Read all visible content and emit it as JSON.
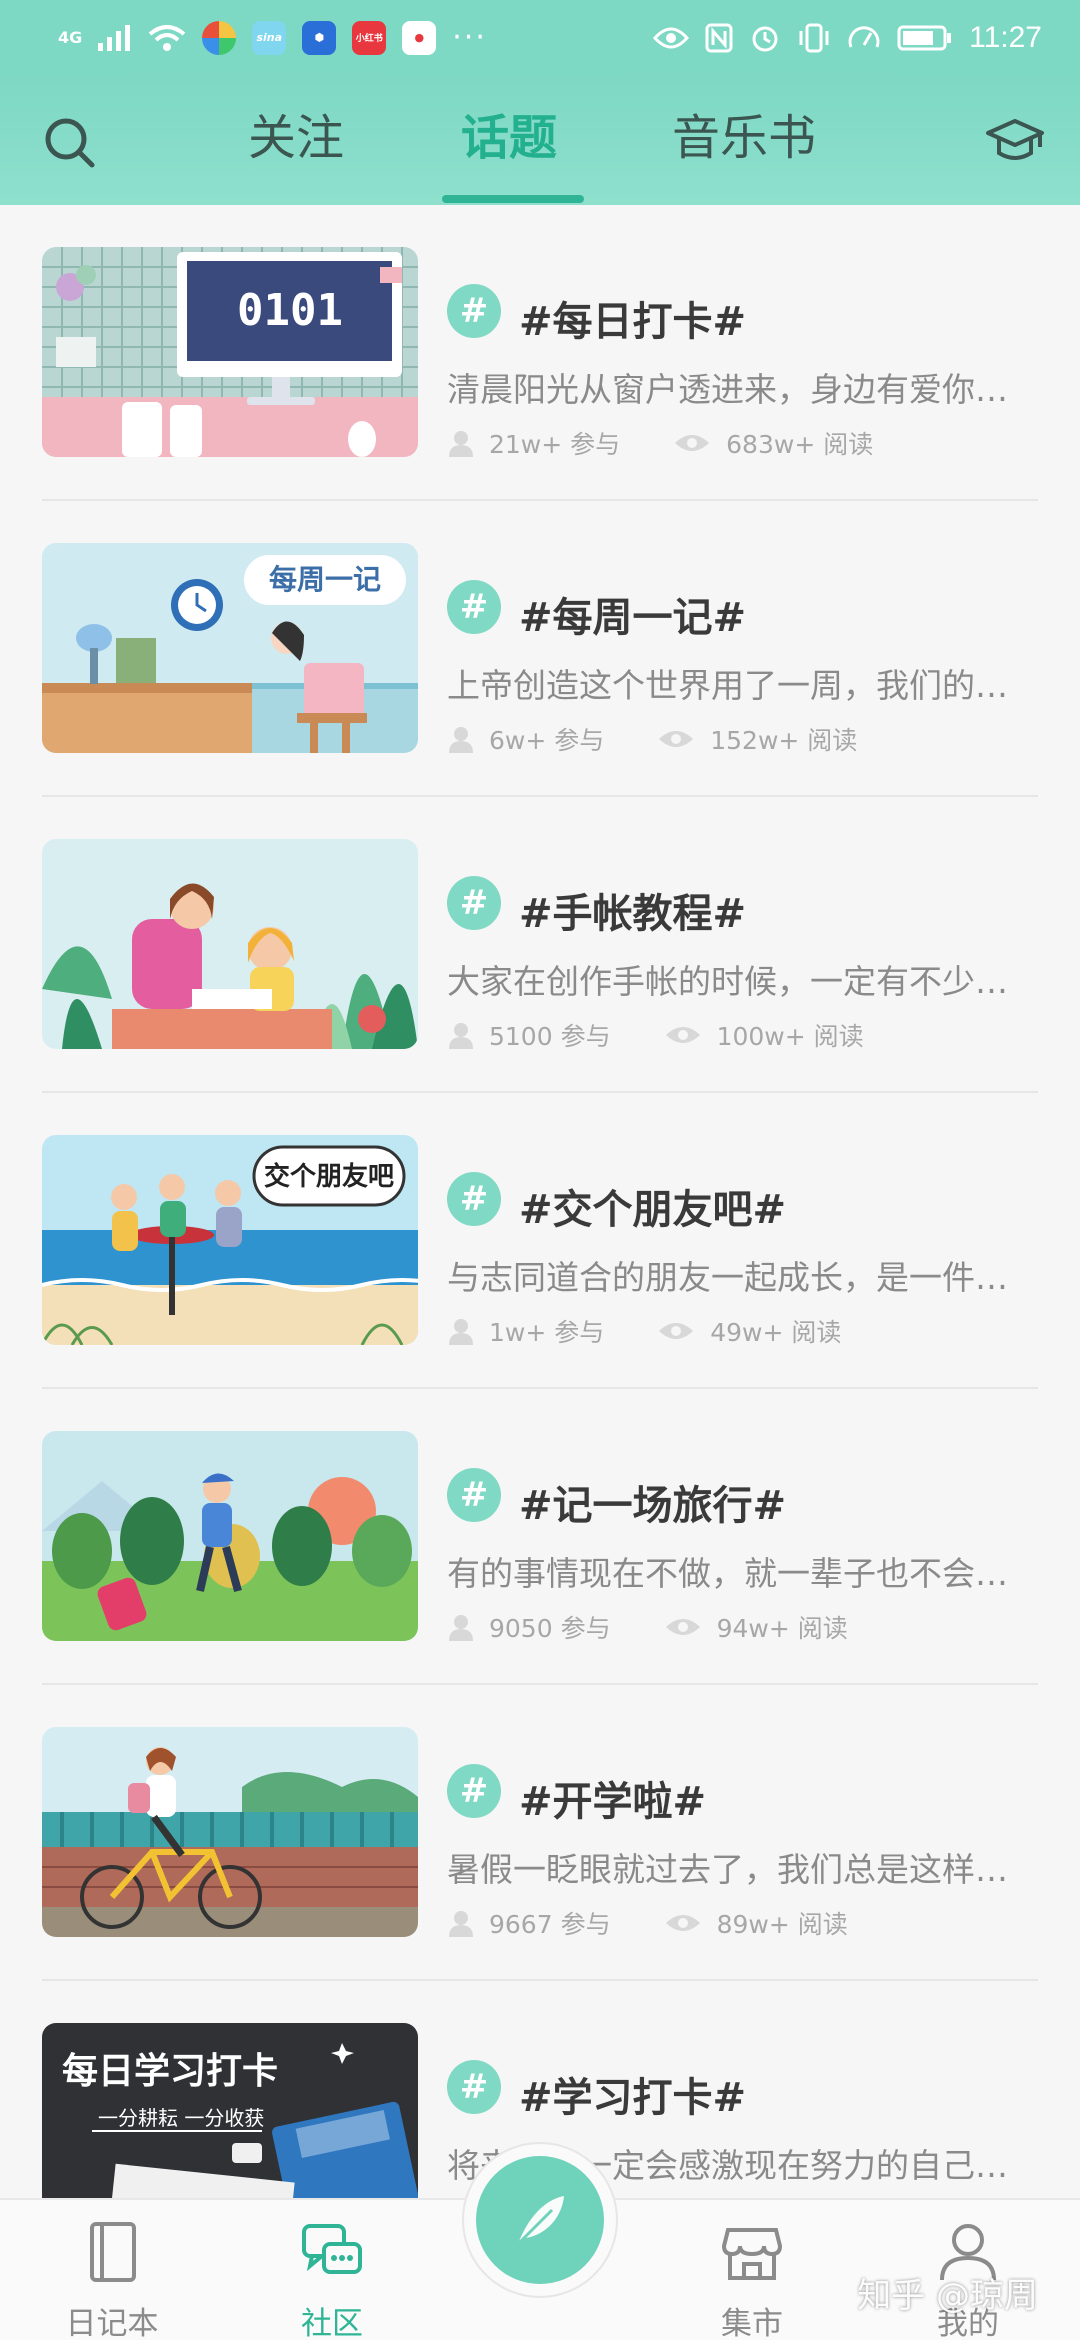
{
  "status_bar": {
    "network": "4G",
    "app_labels": [
      "sina",
      "小红书"
    ],
    "time": "11:27"
  },
  "header": {
    "tabs": [
      {
        "label": "关注",
        "active": false
      },
      {
        "label": "话题",
        "active": true
      },
      {
        "label": "音乐书",
        "active": false
      }
    ],
    "accent_color": "#2fb596"
  },
  "topics": [
    {
      "title": "#每日打卡#",
      "desc": "清晨阳光从窗户透进来，身边有爱你…",
      "participants": "21w+ 参与",
      "reads": "683w+ 阅读",
      "image_text": "0101",
      "image_icon": "desk-monitor-illustration"
    },
    {
      "title": "#每周一记#",
      "desc": "上帝创造这个世界用了一周，我们的…",
      "participants": "6w+ 参与",
      "reads": "152w+ 阅读",
      "image_text": "每周一记",
      "image_icon": "girl-at-desk-illustration"
    },
    {
      "title": "#手帐教程#",
      "desc": "大家在创作手帐的时候，一定有不少…",
      "participants": "5100 参与",
      "reads": "100w+ 阅读",
      "image_text": "",
      "image_icon": "teacher-child-illustration"
    },
    {
      "title": "#交个朋友吧#",
      "desc": "与志同道合的朋友一起成长，是一件…",
      "participants": "1w+ 参与",
      "reads": "49w+ 阅读",
      "image_text": "交个朋友吧",
      "image_icon": "friends-beach-illustration"
    },
    {
      "title": "#记一场旅行#",
      "desc": "有的事情现在不做，就一辈子也不会…",
      "participants": "9050 参与",
      "reads": "94w+ 阅读",
      "image_text": "",
      "image_icon": "traveler-illustration"
    },
    {
      "title": "#开学啦#",
      "desc": "暑假一眨眼就过去了，我们总是这样…",
      "participants": "9667 参与",
      "reads": "89w+ 阅读",
      "image_text": "",
      "image_icon": "girl-bicycle-illustration"
    },
    {
      "title": "#学习打卡#",
      "desc": "将来的你一定会感激现在努力的自己…",
      "participants": "",
      "reads": "",
      "image_text": "每日学习打卡",
      "image_subtext": "一分耕耘 一分收获",
      "image_icon": "chalkboard-illustration"
    }
  ],
  "bottom_nav": {
    "items": [
      {
        "label": "日记本",
        "icon": "notebook-icon",
        "active": false
      },
      {
        "label": "社区",
        "icon": "chat-bubbles-icon",
        "active": true
      },
      {
        "label": "",
        "icon": "feather-icon",
        "active": false
      },
      {
        "label": "集市",
        "icon": "shop-icon",
        "active": false
      },
      {
        "label": "我的",
        "icon": "person-icon",
        "active": false
      }
    ]
  },
  "watermark": "知乎 @琼周"
}
